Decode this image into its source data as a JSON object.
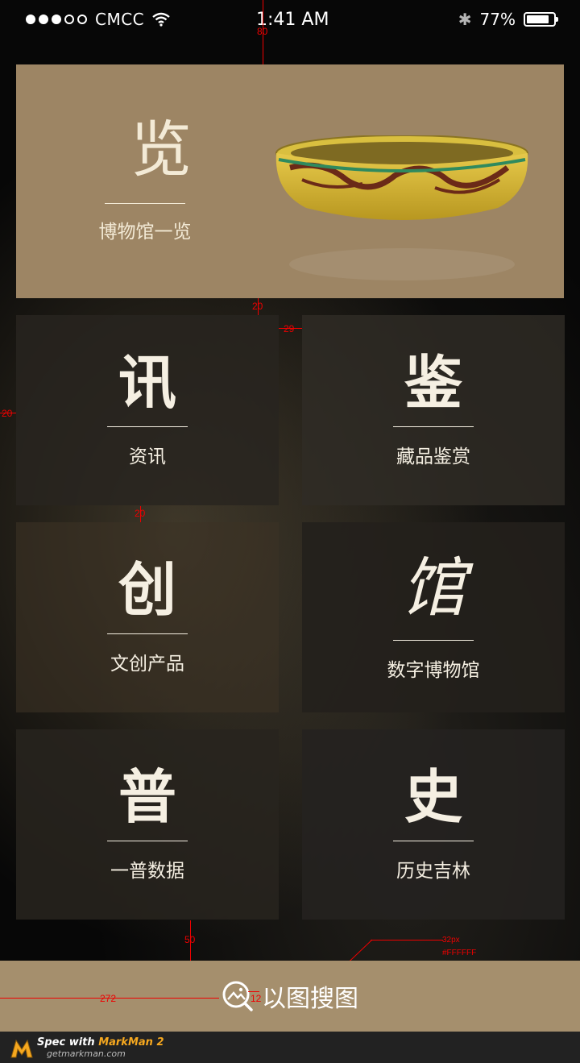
{
  "status_bar": {
    "carrier": "CMCC",
    "time": "1:41 AM",
    "battery": "77%",
    "battery_level": 0.77,
    "signal_bars_filled": 3,
    "signal_bars_total": 5
  },
  "hero": {
    "char": "览",
    "subtitle": "博物馆一览"
  },
  "tiles": [
    {
      "char": "讯",
      "label": "资讯"
    },
    {
      "char": "鉴",
      "label": "藏品鉴赏"
    },
    {
      "char": "创",
      "label": "文创产品"
    },
    {
      "char": "馆",
      "label": "数字博物馆"
    },
    {
      "char": "普",
      "label": "一普数据"
    },
    {
      "char": "史",
      "label": "历史吉林"
    }
  ],
  "search": {
    "label": "以图搜图",
    "icon": "image-search-icon"
  },
  "footer": {
    "spec_prefix": "Spec with ",
    "app_name": "MarkMan 2",
    "url": "getmarkman.com"
  },
  "annotations": {
    "top_gap": "80",
    "hero_gap": "20",
    "col_gap": "29",
    "side_margin": "20",
    "row_gap": "20",
    "bottom_gap": "50",
    "font_size_note": "32px",
    "color_note": "#FFFFFF",
    "search_left": "272",
    "icon_gap": "12"
  },
  "colors": {
    "hero_bg": "#9d8564",
    "search_bg": "#a58f6d",
    "annotation": "#ee0000"
  }
}
